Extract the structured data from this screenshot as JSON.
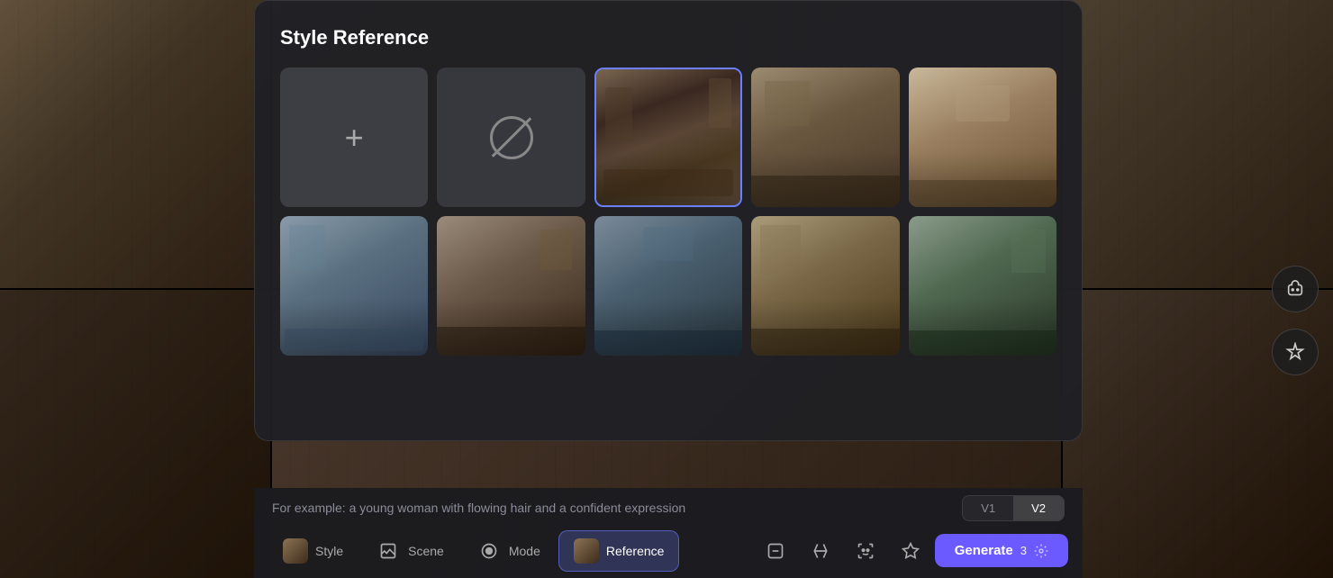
{
  "background": {
    "cells": [
      {
        "id": 1,
        "label": "room-bg-1"
      },
      {
        "id": 2,
        "label": "room-bg-2"
      },
      {
        "id": 3,
        "label": "room-bg-3"
      },
      {
        "id": 4,
        "label": "room-bg-4"
      },
      {
        "id": 5,
        "label": "room-bg-5"
      },
      {
        "id": 6,
        "label": "room-bg-6"
      }
    ]
  },
  "modal": {
    "title": "Style Reference",
    "images": [
      {
        "id": "add",
        "type": "add",
        "label": "Add image"
      },
      {
        "id": "none",
        "type": "none",
        "label": "No style"
      },
      {
        "id": "room1",
        "type": "image",
        "selected": true,
        "room_class": "room-1"
      },
      {
        "id": "room2",
        "type": "image",
        "selected": false,
        "room_class": "room-2"
      },
      {
        "id": "room3",
        "type": "image",
        "selected": false,
        "room_class": "room-3"
      },
      {
        "id": "room4",
        "type": "image",
        "selected": false,
        "room_class": "room-4"
      },
      {
        "id": "room5",
        "type": "image",
        "selected": false,
        "room_class": "room-5"
      },
      {
        "id": "room6",
        "type": "image",
        "selected": false,
        "room_class": "room-6"
      },
      {
        "id": "room7",
        "type": "image",
        "selected": false,
        "room_class": "room-7"
      },
      {
        "id": "room8",
        "type": "image",
        "selected": false,
        "room_class": "room-8"
      }
    ]
  },
  "prompt": {
    "placeholder": "For example: a young woman with flowing hair and a confident expression"
  },
  "versions": {
    "options": [
      {
        "id": "v1",
        "label": "V1",
        "active": false
      },
      {
        "id": "v2",
        "label": "V2",
        "active": true
      }
    ]
  },
  "toolbar": {
    "tabs": [
      {
        "id": "style",
        "label": "Style",
        "active": false,
        "has_thumb": true
      },
      {
        "id": "scene",
        "label": "Scene",
        "active": false,
        "has_thumb": false
      },
      {
        "id": "mode",
        "label": "Mode",
        "active": false,
        "has_thumb": false
      },
      {
        "id": "reference",
        "label": "Reference",
        "active": true,
        "has_thumb": true
      }
    ],
    "icons": [
      {
        "id": "minus-square",
        "label": "Remove"
      },
      {
        "id": "arrow-compare",
        "label": "Compare"
      },
      {
        "id": "face-scan",
        "label": "Face"
      },
      {
        "id": "star",
        "label": "Favorite"
      }
    ],
    "generate": {
      "label": "Generate",
      "count": "3",
      "icon": "settings"
    }
  },
  "float_button": {
    "label": "Assistant"
  }
}
